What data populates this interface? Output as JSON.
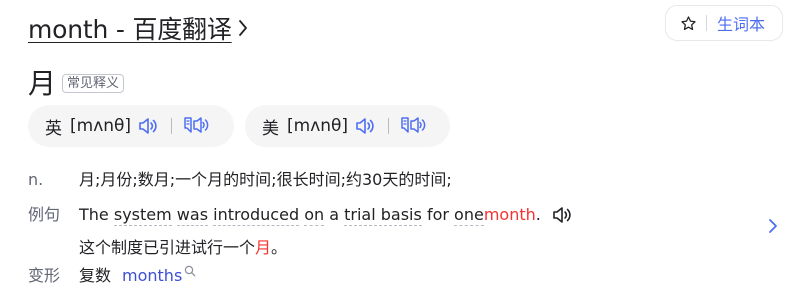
{
  "header": {
    "title": "month - 百度翻译",
    "vocab_label": "生词本"
  },
  "entry": {
    "word": "月",
    "tag": "常见释义"
  },
  "pronunciations": [
    {
      "region": "英",
      "phonetic": "[mʌnθ]"
    },
    {
      "region": "美",
      "phonetic": "[mʌnθ]"
    }
  ],
  "definition": {
    "pos": "n.",
    "text": "月;月份;数月;一个月的时间;很长时间;约30天的时间;"
  },
  "example": {
    "label": "例句",
    "en_words": [
      {
        "t": "The",
        "u": false
      },
      {
        "t": "system",
        "u": true
      },
      {
        "t": "was",
        "u": true
      },
      {
        "t": "introduced",
        "u": true
      },
      {
        "t": "on",
        "u": true
      },
      {
        "t": "a",
        "u": false
      },
      {
        "t": "trial basis",
        "u": true
      },
      {
        "t": "for",
        "u": false
      },
      {
        "t": "one",
        "u": true
      }
    ],
    "en_highlight": "month",
    "en_end": ".",
    "cn_before": "这个制度已引进试行一个",
    "cn_highlight": "月",
    "cn_after": "。"
  },
  "inflection": {
    "label": "变形",
    "type": "复数",
    "form": "months"
  },
  "colors": {
    "accent": "#4e6ef2",
    "highlight": "#f73131",
    "link": "#3e4ed6",
    "muted": "#626675"
  },
  "icons": [
    "chevron-right-icon",
    "star-icon",
    "speaker-icon",
    "follow-read-icon",
    "search-icon"
  ]
}
